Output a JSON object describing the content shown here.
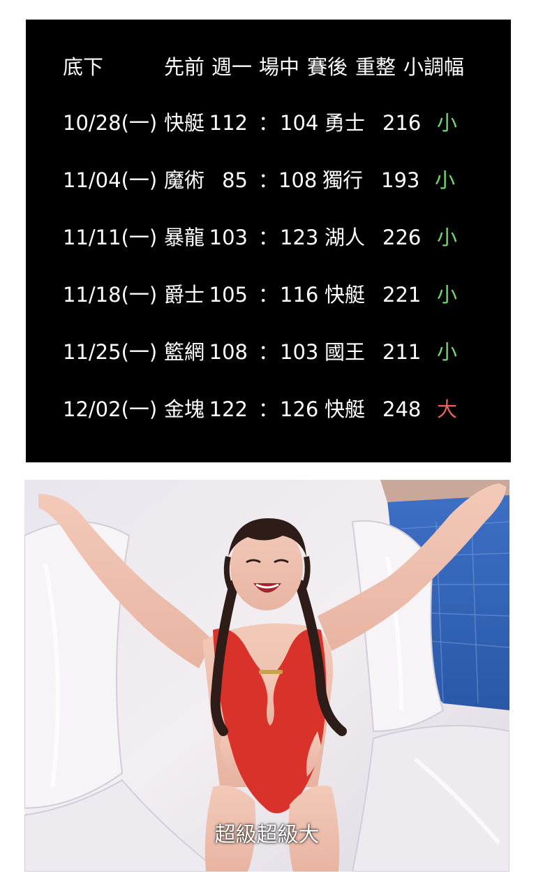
{
  "table": {
    "headers": {
      "col1": "底下",
      "col2": "先前",
      "col3": "週一",
      "col4": "場中",
      "col5": "賽後",
      "col6": "重整",
      "col7": "小調幅"
    },
    "rows": [
      {
        "date": "10/28(一)",
        "home": "快艇",
        "home_score": "112",
        "colon": "：",
        "away_score": "104",
        "away": "勇士",
        "total": "216",
        "result": "小"
      },
      {
        "date": "11/04(一)",
        "home": "魔術",
        "home_score": "85",
        "colon": "：",
        "away_score": "108",
        "away": "獨行",
        "total": "193",
        "result": "小"
      },
      {
        "date": "11/11(一)",
        "home": "暴龍",
        "home_score": "103",
        "colon": "：",
        "away_score": "123",
        "away": "湖人",
        "total": "226",
        "result": "小"
      },
      {
        "date": "11/18(一)",
        "home": "爵士",
        "home_score": "105",
        "colon": "：",
        "away_score": "116",
        "away": "快艇",
        "total": "221",
        "result": "小"
      },
      {
        "date": "11/25(一)",
        "home": "籃網",
        "home_score": "108",
        "colon": "：",
        "away_score": "103",
        "away": "國王",
        "total": "211",
        "result": "小"
      },
      {
        "date": "12/02(一)",
        "home": "金塊",
        "home_score": "122",
        "colon": "：",
        "away_score": "126",
        "away": "快艇",
        "total": "248",
        "result": "大"
      }
    ]
  },
  "colors": {
    "panel_bg": "#000000",
    "text": "#ffffff",
    "small_result": "#6fdc6f",
    "big_result": "#e8645a"
  },
  "photo": {
    "caption": "超級超級大"
  }
}
